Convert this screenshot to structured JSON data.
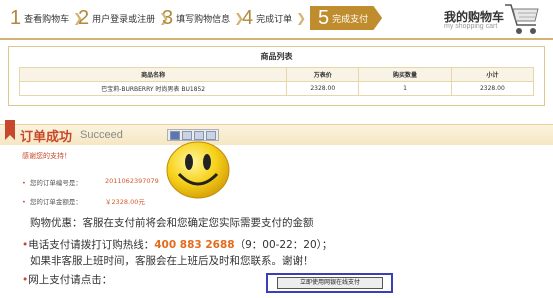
{
  "steps": [
    {
      "num": "1",
      "label": "查看购物车"
    },
    {
      "num": "2",
      "label": "用户登录或注册"
    },
    {
      "num": "3",
      "label": "填写购物信息"
    },
    {
      "num": "4",
      "label": "完成订单"
    },
    {
      "num": "5",
      "label": "完成支付"
    }
  ],
  "cart": {
    "title": "我的购物车",
    "subtitle": "my shopping cart"
  },
  "product_list": {
    "title": "商品列表",
    "headers": [
      "商品名称",
      "万表价",
      "购买数量",
      "小计"
    ],
    "rows": [
      [
        "巴宝莉-BURBERRY 时尚男表 BU1852",
        "2328.00",
        "1",
        "2328.00"
      ]
    ]
  },
  "success": {
    "title": "订单成功",
    "title_en": "Succeed",
    "thanks": "感谢您的支持！"
  },
  "order": {
    "number_label": "您的订单编号是：",
    "number_value": "2011062397079",
    "amount_label": "您的订单金额是：",
    "amount_value": "￥2328.00元"
  },
  "promo": "购物优惠：客服在支付前将会和您确定您实际需要支付的金额",
  "phone": {
    "prefix": "电话支付请拨打订购热线：",
    "number": "400 883 2688",
    "hours": "（9：00-22：20）；",
    "line2": "如果非客服上班时间，客服会在上班后及时和您联系。谢谢！"
  },
  "online_label": "网上支付请点击：",
  "pay_button": "立即使用网银在线支付",
  "colors": {
    "accent": "#c8482c",
    "gold": "#c08d2e",
    "phone": "#e46a1c"
  }
}
